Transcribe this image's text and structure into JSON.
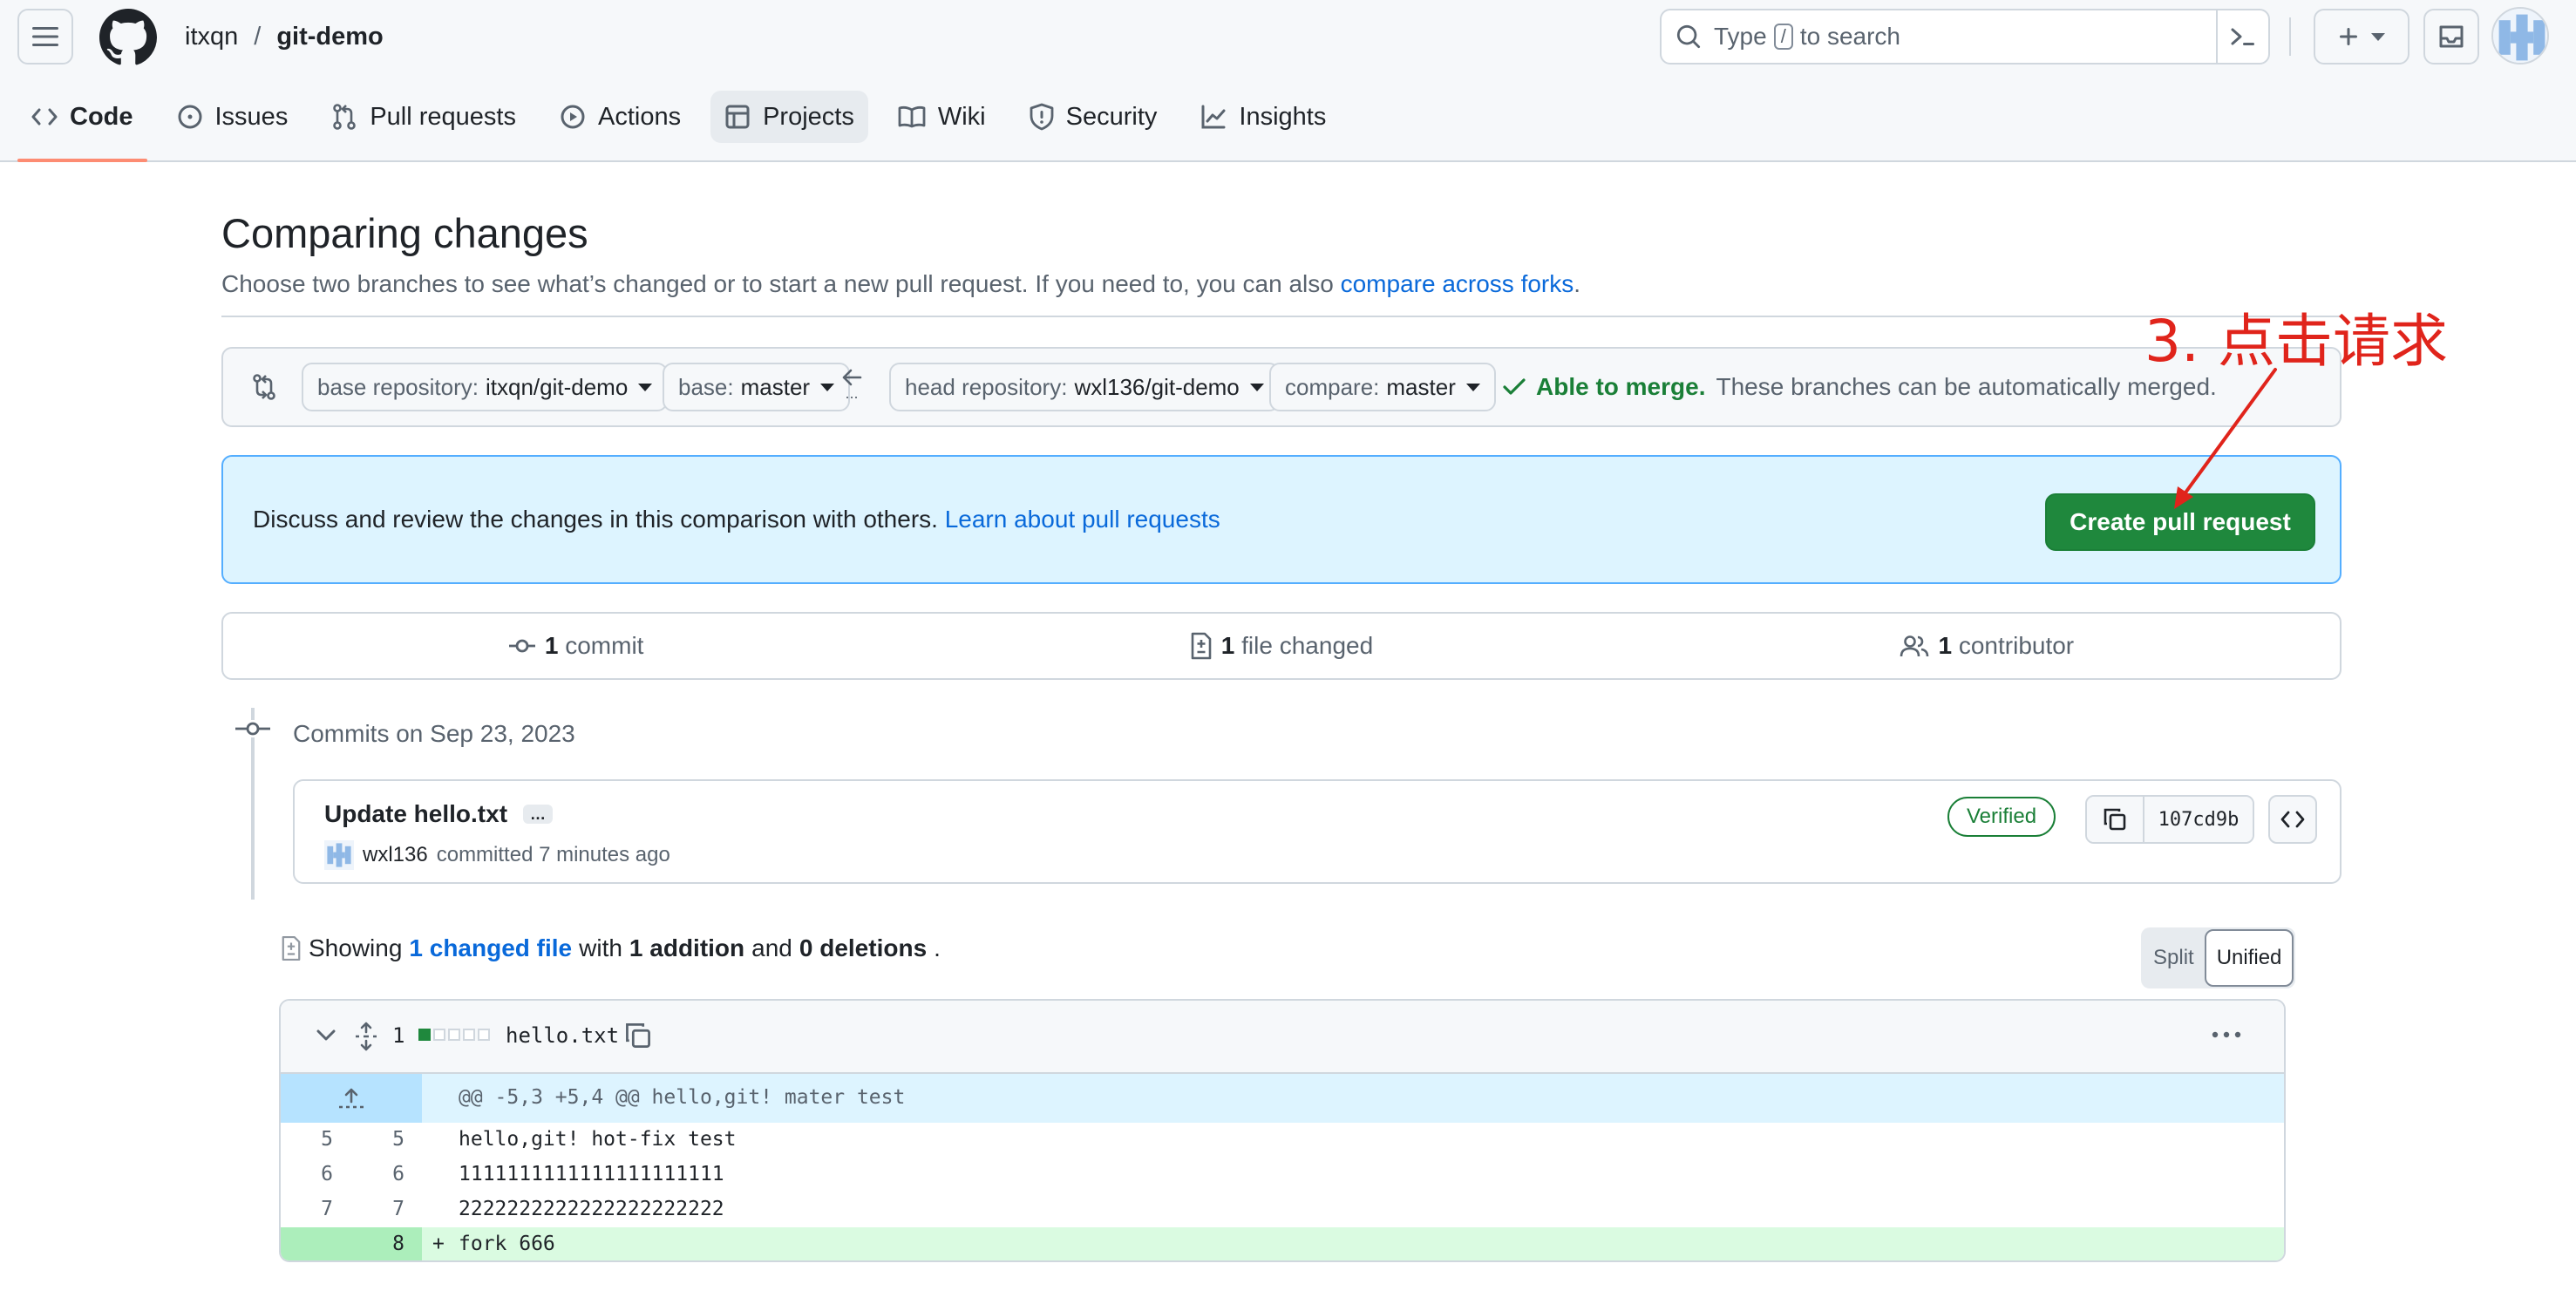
{
  "header": {
    "owner": "itxqn",
    "separator": "/",
    "repo": "git-demo",
    "search_placeholder_pre": "Type",
    "search_key": "/",
    "search_placeholder_post": "to search"
  },
  "tabs": [
    {
      "label": "Code",
      "icon": "code-icon",
      "active": true
    },
    {
      "label": "Issues",
      "icon": "issue-icon"
    },
    {
      "label": "Pull requests",
      "icon": "pull-request-icon"
    },
    {
      "label": "Actions",
      "icon": "play-icon"
    },
    {
      "label": "Projects",
      "icon": "table-icon",
      "highlight": true
    },
    {
      "label": "Wiki",
      "icon": "book-icon"
    },
    {
      "label": "Security",
      "icon": "shield-icon"
    },
    {
      "label": "Insights",
      "icon": "graph-icon"
    }
  ],
  "page": {
    "title": "Comparing changes",
    "subtitle": "Choose two branches to see what’s changed or to start a new pull request. If you need to, you can also",
    "subtitle_link": "compare across forks",
    "subtitle_end": "."
  },
  "range": {
    "base_repo_label": "base repository:",
    "base_repo_value": "itxqn/git-demo",
    "base_label": "base:",
    "base_value": "master",
    "arrow_dots": "...",
    "head_repo_label": "head repository:",
    "head_repo_value": "wxl136/git-demo",
    "compare_label": "compare:",
    "compare_value": "master",
    "merge_status": "Able to merge.",
    "merge_detail": "These branches can be automatically merged."
  },
  "flash": {
    "text": "Discuss and review the changes in this comparison with others.",
    "link": "Learn about pull requests",
    "button": "Create pull request"
  },
  "summary": {
    "commits_count": "1",
    "commits_label": "commit",
    "files_count": "1",
    "files_label": "file changed",
    "contrib_count": "1",
    "contrib_label": "contributor"
  },
  "commits": {
    "date_heading": "Commits on Sep 23, 2023",
    "title": "Update hello.txt",
    "more": "…",
    "author": "wxl136",
    "action": "committed 7 minutes ago",
    "verified": "Verified",
    "sha": "107cd9b"
  },
  "diff_summary": {
    "showing": "Showing",
    "changed_files": "1 changed file",
    "with": "with",
    "additions": "1 addition",
    "and": "and",
    "deletions": "0 deletions",
    "end": ".",
    "split": "Split",
    "unified": "Unified"
  },
  "file": {
    "changes": "1",
    "name": "hello.txt",
    "hunk_header": "@@ -5,3 +5,4 @@ hello,git! mater test",
    "lines": [
      {
        "old": "5",
        "new": "5",
        "sign": "",
        "code": "hello,git! hot-fix test",
        "type": "context"
      },
      {
        "old": "6",
        "new": "6",
        "sign": "",
        "code": "1111111111111111111111",
        "type": "context"
      },
      {
        "old": "7",
        "new": "7",
        "sign": "",
        "code": "2222222222222222222222",
        "type": "context"
      },
      {
        "old": "",
        "new": "8",
        "sign": "+",
        "code": "fork 666",
        "type": "add"
      }
    ]
  },
  "annotation": {
    "text": "3. 点击请求",
    "color": "#e0241b"
  },
  "colors": {
    "accent": "#0969da",
    "success": "#1f883d",
    "tab_underline": "#fd8c73"
  }
}
